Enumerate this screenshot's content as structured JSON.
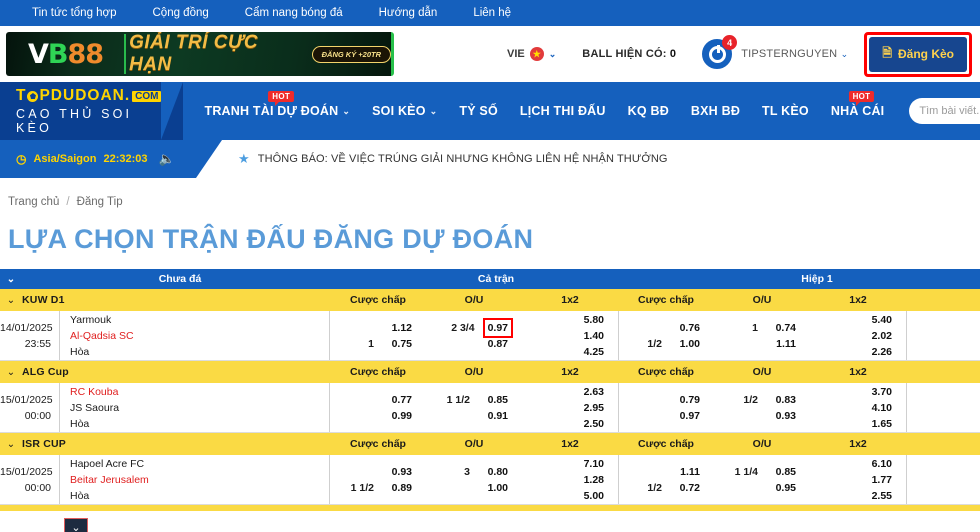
{
  "topbar": {
    "links": [
      "Tin tức tổng hợp",
      "Cộng đồng",
      "Cẩm nang bóng đá",
      "Hướng dẫn",
      "Liên hệ"
    ]
  },
  "banner": {
    "brand_v": "V",
    "brand_b": "B",
    "brand_num": "88",
    "slogan": "GIẢI TRÍ CỰC HẠN",
    "pill": "ĐĂNG KÝ +20TR"
  },
  "header": {
    "lang": "VIE",
    "ball_label": "BALL HIỆN CÓ:",
    "ball_value": "0",
    "notification_count": "4",
    "username": "TIPSTERNGUYEN",
    "post_button": "Đăng Kèo",
    "post_icon": "document-icon",
    "chevron": "⌄"
  },
  "logo": {
    "line1_left": "T",
    "line1_mid": "PDUDOAN.",
    "com": "COM",
    "line2": "CAO THỦ SOI KÈO"
  },
  "nav": {
    "items": [
      {
        "label": "TRANH TÀI DỰ ĐOÁN",
        "dropdown": true,
        "hot": true
      },
      {
        "label": "SOI KÈO",
        "dropdown": true,
        "hot": false
      },
      {
        "label": "TỶ SỐ",
        "dropdown": false,
        "hot": false
      },
      {
        "label": "LỊCH THI ĐẤU",
        "dropdown": false,
        "hot": false
      },
      {
        "label": "KQ BĐ",
        "dropdown": false,
        "hot": false
      },
      {
        "label": "BXH BĐ",
        "dropdown": false,
        "hot": false
      },
      {
        "label": "TL KÈO",
        "dropdown": false,
        "hot": false
      },
      {
        "label": "NHÀ CÁI",
        "dropdown": false,
        "hot": true
      }
    ],
    "hot_label": "HOT",
    "search_placeholder": "Tìm bài viết...",
    "search_value": ""
  },
  "ticker": {
    "timezone": "Asia/Saigon",
    "time": "22:32:03",
    "clock_icon": "clock-icon",
    "speaker_icon": "speaker-icon",
    "star_icon": "star-icon",
    "message": "THÔNG BÁO: VỀ VIỆC TRÚNG GIẢI NHƯNG KHÔNG LIÊN HỆ NHẬN THƯỞNG"
  },
  "breadcrumb": {
    "home": "Trang chủ",
    "sep": "/",
    "current": "Đăng Tip"
  },
  "page_title": "LỰA CHỌN TRẬN ĐẤU ĐĂNG DỰ ĐOÁN",
  "table": {
    "header": {
      "status": "Chưa đá",
      "full_match": "Cả trận",
      "first_half": "Hiệp 1"
    },
    "columns": [
      "Cược chấp",
      "O/U",
      "1x2",
      "Cược chấp",
      "O/U",
      "1x2"
    ],
    "leagues": [
      {
        "name": "KUW D1",
        "matches": [
          {
            "date": "14/01/2025",
            "time": "23:55",
            "home": "Yarmouk",
            "away": "Al-Qadsia SC",
            "draw": "Hòa",
            "home_red": false,
            "away_red": true,
            "full": {
              "hc": {
                "h1": "",
                "v1": "1.12",
                "h2": "1",
                "v2": "0.75"
              },
              "ou": {
                "h1": "2 3/4",
                "v1": "0.97",
                "h2": "",
                "v2": "0.87",
                "highlight": true
              },
              "x12": {
                "v1": "5.80",
                "v2": "1.40",
                "v3": "4.25"
              }
            },
            "half": {
              "hc": {
                "h1": "",
                "v1": "0.76",
                "h2": "1/2",
                "v2": "1.00"
              },
              "ou": {
                "h1": "1",
                "v1": "0.74",
                "h2": "",
                "v2": "1.11"
              },
              "x12": {
                "v1": "5.40",
                "v2": "2.02",
                "v3": "2.26"
              }
            }
          }
        ]
      },
      {
        "name": "ALG Cup",
        "matches": [
          {
            "date": "15/01/2025",
            "time": "00:00",
            "home": "RC Kouba",
            "away": "JS Saoura",
            "draw": "Hòa",
            "home_red": true,
            "away_red": false,
            "full": {
              "hc": {
                "h1": "",
                "v1": "0.77",
                "h2": "",
                "v2": "0.99"
              },
              "ou": {
                "h1": "1 1/2",
                "v1": "0.85",
                "h2": "",
                "v2": "0.91"
              },
              "x12": {
                "v1": "2.63",
                "v2": "2.95",
                "v3": "2.50"
              }
            },
            "half": {
              "hc": {
                "h1": "",
                "v1": "0.79",
                "h2": "",
                "v2": "0.97"
              },
              "ou": {
                "h1": "1/2",
                "v1": "0.83",
                "h2": "",
                "v2": "0.93"
              },
              "x12": {
                "v1": "3.70",
                "v2": "4.10",
                "v3": "1.65"
              }
            }
          }
        ]
      },
      {
        "name": "ISR CUP",
        "matches": [
          {
            "date": "15/01/2025",
            "time": "00:00",
            "home": "Hapoel Acre FC",
            "away": "Beitar Jerusalem",
            "draw": "Hòa",
            "home_red": false,
            "away_red": true,
            "full": {
              "hc": {
                "h1": "",
                "v1": "0.93",
                "h2": "1 1/2",
                "v2": "0.89"
              },
              "ou": {
                "h1": "3",
                "v1": "0.80",
                "h2": "",
                "v2": "1.00"
              },
              "x12": {
                "v1": "7.10",
                "v2": "1.28",
                "v3": "5.00"
              }
            },
            "half": {
              "hc": {
                "h1": "",
                "v1": "1.11",
                "h2": "1/2",
                "v2": "0.72"
              },
              "ou": {
                "h1": "1 1/4",
                "v1": "0.85",
                "h2": "",
                "v2": "0.95"
              },
              "x12": {
                "v1": "6.10",
                "v2": "1.77",
                "v3": "2.55"
              }
            }
          }
        ]
      }
    ],
    "collapse_chevron": "⌄",
    "scroll_chevron": "⌄"
  },
  "colors": {
    "blue": "#1560bd",
    "dark_blue": "#0a3f91",
    "yellow": "#fada44",
    "title_blue": "#5a9bd8",
    "red": "#e02020",
    "highlight": "#ff0000",
    "button_blue": "#17468f",
    "button_text": "#ffd24d"
  }
}
